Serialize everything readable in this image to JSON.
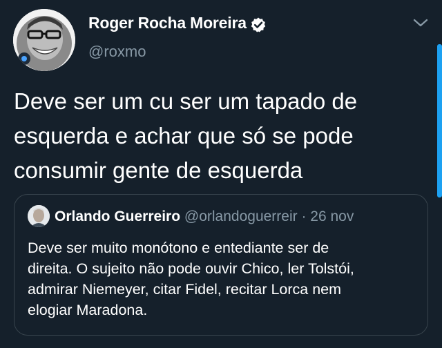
{
  "tweet": {
    "author_name": "Roger Rocha Moreira",
    "handle": "@roxmo",
    "text": "Deve ser um cu ser um tapado de\nesquerda e achar que só se pode\nconsumir gente de esquerda",
    "verified_icon": "verified-badge-icon",
    "menu_icon": "chevron-down-icon"
  },
  "quoted_tweet": {
    "author_name": "Orlando Guerreiro",
    "handle": "@orlandoguerreir",
    "separator": " · ",
    "date": "26 nov",
    "text": "Deve ser muito monótono e entediante ser de\ndireita. O sujeito não pode ouvir Chico, ler Tolstói,\nadmirar Niemeyer, citar Fidel, recitar Lorca nem\nelogiar Maradona."
  },
  "colors": {
    "background": "#15202b",
    "text": "#ffffff",
    "secondary_text": "#8899a6",
    "border": "#38444d",
    "accent": "#1da1f2"
  }
}
